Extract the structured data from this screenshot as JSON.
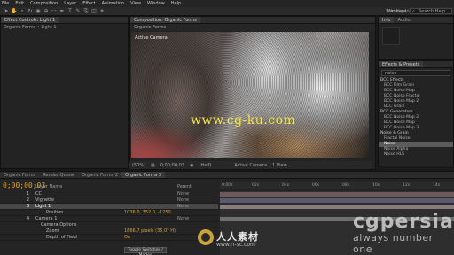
{
  "menu": [
    "File",
    "Edit",
    "Composition",
    "Layer",
    "Effect",
    "Animation",
    "View",
    "Window",
    "Help"
  ],
  "toolbar": {
    "workspace_label": "Workspace:",
    "workspace_value": "Standard",
    "search_placeholder": "Search Help"
  },
  "project_panel": {
    "tab": "Effect Controls: Light 1",
    "sub": "Organic Forms • Light 1"
  },
  "composition": {
    "tab": "Composition: Organic Forms",
    "sub_tab": "Organic Forms",
    "active_camera_label": "Active Camera"
  },
  "watermark_text": "www.cg-ku.com",
  "viewer_bar": {
    "zoom": "(50%)",
    "time": "0;00;00;03",
    "quality": "(Half)",
    "camera": "Active Camera",
    "views": "1 View"
  },
  "info_panel": {
    "tabs": [
      "Info",
      "Audio"
    ]
  },
  "effects_panel": {
    "tabs": [
      "Effects & Presets"
    ],
    "search": "noise",
    "items": [
      {
        "label": "BCC Effects",
        "group": true
      },
      {
        "label": "BCC Film Grain",
        "group": false
      },
      {
        "label": "BCC Noise Map",
        "group": false
      },
      {
        "label": "BCC Noise Fractal",
        "group": false
      },
      {
        "label": "BCC Noise Map 2",
        "group": false
      },
      {
        "label": "BCC Grain",
        "group": false
      },
      {
        "label": "BCC Generators",
        "group": true
      },
      {
        "label": "BCC Noise Map 2",
        "group": false
      },
      {
        "label": "BCC Noise Map",
        "group": false
      },
      {
        "label": "BCC Noise Map 3",
        "group": false
      },
      {
        "label": "Noise & Grain",
        "group": true
      },
      {
        "label": "Fractal Noise",
        "group": false
      },
      {
        "label": "Noise",
        "group": false,
        "selected": true
      },
      {
        "label": "Noise Alpha",
        "group": false
      },
      {
        "label": "Noise HLS",
        "group": false
      }
    ]
  },
  "timeline": {
    "tabs": [
      "Organic Forms",
      "Render Queue",
      "Organic Forms 2",
      "Organic Forms 3"
    ],
    "timecode": "0;00;00;03",
    "columns": [
      "Layer Name",
      "Parent"
    ],
    "rows": [
      {
        "num": "1",
        "name": "CC",
        "selected": false,
        "value": "",
        "mode": "None"
      },
      {
        "num": "2",
        "name": "Vignette",
        "selected": false,
        "value": "",
        "mode": "None"
      },
      {
        "num": "3",
        "name": "Light 1",
        "selected": true,
        "value": "",
        "mode": "None"
      },
      {
        "num": "",
        "name": "Position",
        "selected": false,
        "value": "1036.0, 352.0, -1250",
        "mode": ""
      },
      {
        "num": "4",
        "name": "Camera 1",
        "selected": false,
        "value": "",
        "mode": "None"
      },
      {
        "num": "",
        "name": "Camera Options",
        "selected": false,
        "value": "",
        "mode": ""
      },
      {
        "num": "",
        "name": "Zoom",
        "selected": false,
        "value": "1866.7 pixels (35.0° H)",
        "mode": ""
      },
      {
        "num": "",
        "name": "Depth of Field",
        "selected": false,
        "value": "On",
        "mode": ""
      }
    ],
    "toggle_button": "Toggle Switches / Modes",
    "ruler": [
      "0:00s",
      "02s",
      "04s",
      "06s",
      "08s",
      "10s",
      "12s",
      "14s"
    ]
  },
  "branding": {
    "name": "cgpersia",
    "tagline": "always number one",
    "cn_name": "人人素材",
    "cn_url": "www.rr-sc.com"
  }
}
